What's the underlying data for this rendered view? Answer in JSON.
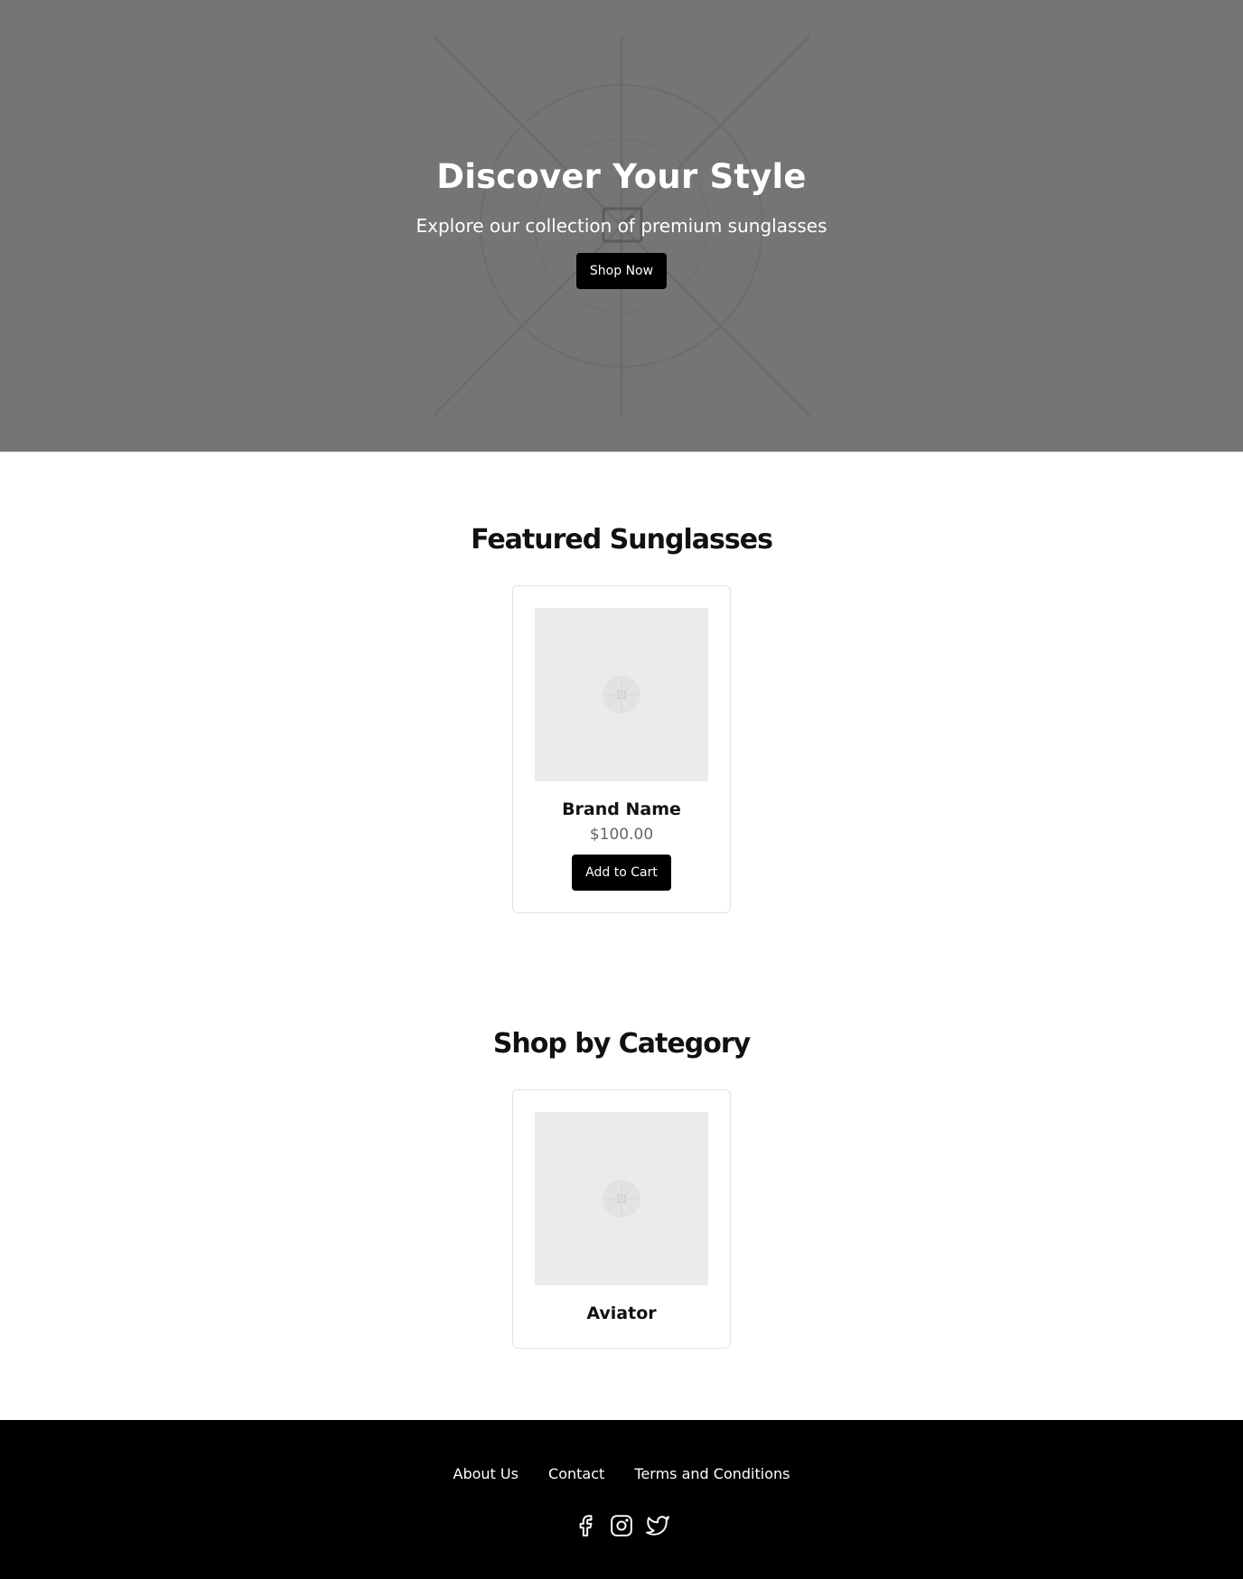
{
  "hero": {
    "title": "Discover Your Style",
    "subtitle": "Explore our collection of premium sunglasses",
    "button_label": "Shop Now",
    "background_color": "#757575"
  },
  "featured": {
    "title": "Featured Sunglasses",
    "products": [
      {
        "name": "Brand Name",
        "price": "$100.00",
        "button_label": "Add to Cart",
        "image_icon": "image-placeholder-icon"
      }
    ]
  },
  "categories": {
    "title": "Shop by Category",
    "items": [
      {
        "name": "Aviator",
        "image_icon": "image-placeholder-icon"
      }
    ]
  },
  "footer": {
    "links": [
      "About Us",
      "Contact",
      "Terms and Conditions"
    ],
    "social_icons": [
      "facebook-icon",
      "instagram-icon",
      "twitter-icon"
    ],
    "background_color": "#000000"
  }
}
